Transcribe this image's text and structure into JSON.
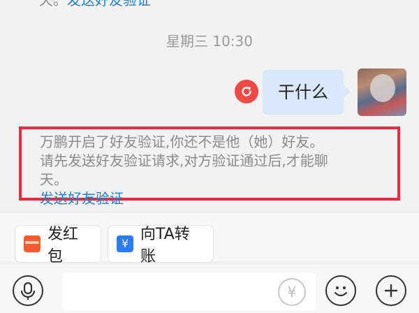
{
  "chat": {
    "previous_notice_prefix": "天。",
    "previous_notice_link": "发送好友验证",
    "timestamp": "星期三 10:30",
    "message_text": "干什么",
    "system_line1": "万鹏开启了好友验证,你还不是他（她）好友。",
    "system_line2": "请先发送好友验证请求,对方验证通过后,才能聊",
    "system_line3_prefix": "天。",
    "system_link": "发送好友验证"
  },
  "toolbar": {
    "red_packet_label": "发红包",
    "transfer_icon_glyph": "¥",
    "transfer_label": "向TA转账"
  },
  "input_bar": {
    "yuan_glyph": "¥"
  },
  "colors": {
    "highlight_border": "#ee2b3a",
    "link": "#1e7fd6",
    "bubble": "#d9e8fb",
    "resend": "#f04a47"
  },
  "icons": [
    "refresh-icon",
    "red-packet-icon",
    "transfer-icon",
    "microphone-icon",
    "yuan-icon",
    "emoji-icon",
    "plus-icon"
  ]
}
